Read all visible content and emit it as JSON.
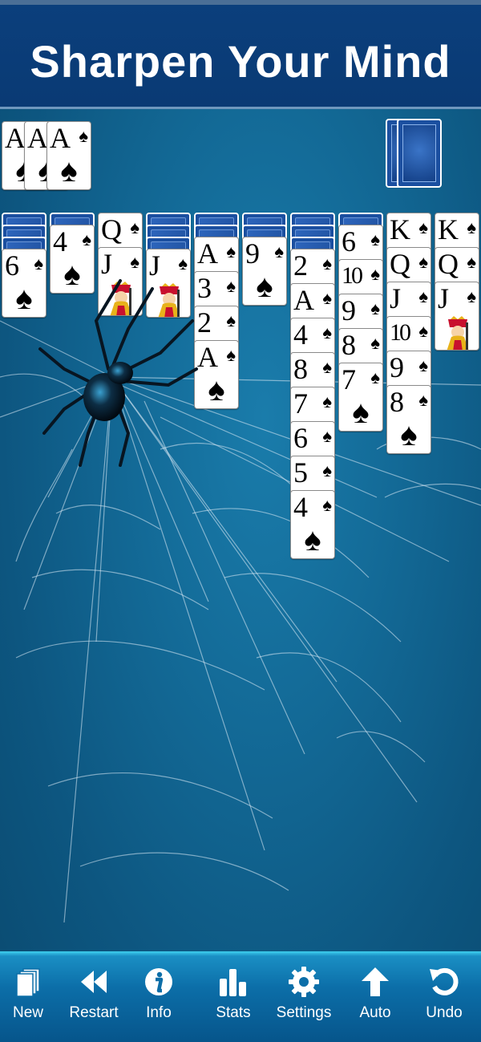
{
  "banner": {
    "title": "Sharpen Your Mind"
  },
  "foundation": [
    {
      "rank": "A",
      "suit": "♠"
    },
    {
      "rank": "A",
      "suit": "♠"
    },
    {
      "rank": "A",
      "suit": "♠"
    }
  ],
  "stock": {
    "remaining_deals": 2
  },
  "tableau": [
    {
      "hidden": 3,
      "cards": [
        {
          "rank": "6",
          "suit": "♠"
        }
      ]
    },
    {
      "hidden": 1,
      "cards": [
        {
          "rank": "4",
          "suit": "♠"
        }
      ]
    },
    {
      "hidden": 0,
      "cards": [
        {
          "rank": "Q",
          "suit": "♠"
        },
        {
          "rank": "J",
          "suit": "♠"
        }
      ]
    },
    {
      "hidden": 3,
      "cards": [
        {
          "rank": "J",
          "suit": "♠"
        }
      ]
    },
    {
      "hidden": 2,
      "cards": [
        {
          "rank": "A",
          "suit": "♠"
        },
        {
          "rank": "3",
          "suit": "♠"
        },
        {
          "rank": "2",
          "suit": "♠"
        },
        {
          "rank": "A",
          "suit": "♠"
        }
      ]
    },
    {
      "hidden": 2,
      "cards": [
        {
          "rank": "9",
          "suit": "♠"
        }
      ]
    },
    {
      "hidden": 3,
      "cards": [
        {
          "rank": "2",
          "suit": "♠"
        },
        {
          "rank": "A",
          "suit": "♠"
        },
        {
          "rank": "4",
          "suit": "♠"
        },
        {
          "rank": "8",
          "suit": "♠"
        },
        {
          "rank": "7",
          "suit": "♠"
        },
        {
          "rank": "6",
          "suit": "♠"
        },
        {
          "rank": "5",
          "suit": "♠"
        },
        {
          "rank": "4",
          "suit": "♠"
        }
      ]
    },
    {
      "hidden": 1,
      "cards": [
        {
          "rank": "6",
          "suit": "♠"
        },
        {
          "rank": "10",
          "suit": "♠"
        },
        {
          "rank": "9",
          "suit": "♠"
        },
        {
          "rank": "8",
          "suit": "♠"
        },
        {
          "rank": "7",
          "suit": "♠"
        }
      ]
    },
    {
      "hidden": 0,
      "cards": [
        {
          "rank": "K",
          "suit": "♠"
        },
        {
          "rank": "Q",
          "suit": "♠"
        },
        {
          "rank": "J",
          "suit": "♠"
        },
        {
          "rank": "10",
          "suit": "♠"
        },
        {
          "rank": "9",
          "suit": "♠"
        },
        {
          "rank": "8",
          "suit": "♠"
        }
      ]
    },
    {
      "hidden": 0,
      "cards": [
        {
          "rank": "K",
          "suit": "♠"
        },
        {
          "rank": "Q",
          "suit": "♠"
        },
        {
          "rank": "J",
          "suit": "♠"
        }
      ]
    }
  ],
  "toolbar": {
    "items": [
      {
        "label": "New",
        "icon": "new-deck-icon"
      },
      {
        "label": "Restart",
        "icon": "rewind-icon"
      },
      {
        "label": "Info",
        "icon": "info-icon"
      },
      {
        "label": "Stats",
        "icon": "bar-chart-icon"
      },
      {
        "label": "Settings",
        "icon": "gear-icon"
      },
      {
        "label": "Auto",
        "icon": "arrow-up-icon"
      },
      {
        "label": "Undo",
        "icon": "undo-icon"
      }
    ]
  },
  "colors": {
    "felt": "#136a97",
    "banner": "#0b3f7c",
    "toolbar": "#0c6ea8",
    "card_back": "#1b4fa0"
  }
}
